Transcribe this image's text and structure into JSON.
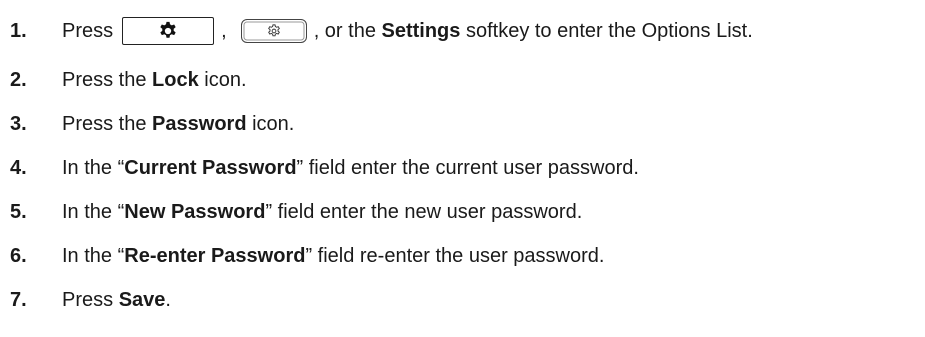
{
  "steps": [
    {
      "number": "1.",
      "pre": "Press",
      "comma1": ",",
      "post": ", or the ",
      "bold": "Settings",
      "tail": " softkey to enter the Options List.",
      "icons": [
        "gear-icon",
        "settings-button-icon"
      ]
    },
    {
      "number": "2.",
      "pre": "Press the ",
      "bold": "Lock",
      "tail": " icon."
    },
    {
      "number": "3.",
      "pre": "Press the ",
      "bold": "Password",
      "tail": " icon."
    },
    {
      "number": "4.",
      "pre": "In the “",
      "bold": "Current Password",
      "tail": "” field enter the current user password."
    },
    {
      "number": "5.",
      "pre": "In the “",
      "bold": "New Password",
      "tail": "” field enter the new user password."
    },
    {
      "number": "6.",
      "pre": "In the “",
      "bold": "Re-enter Password",
      "tail": "” field re-enter the user password."
    },
    {
      "number": "7.",
      "pre": "Press ",
      "bold": "Save",
      "tail": "."
    }
  ]
}
